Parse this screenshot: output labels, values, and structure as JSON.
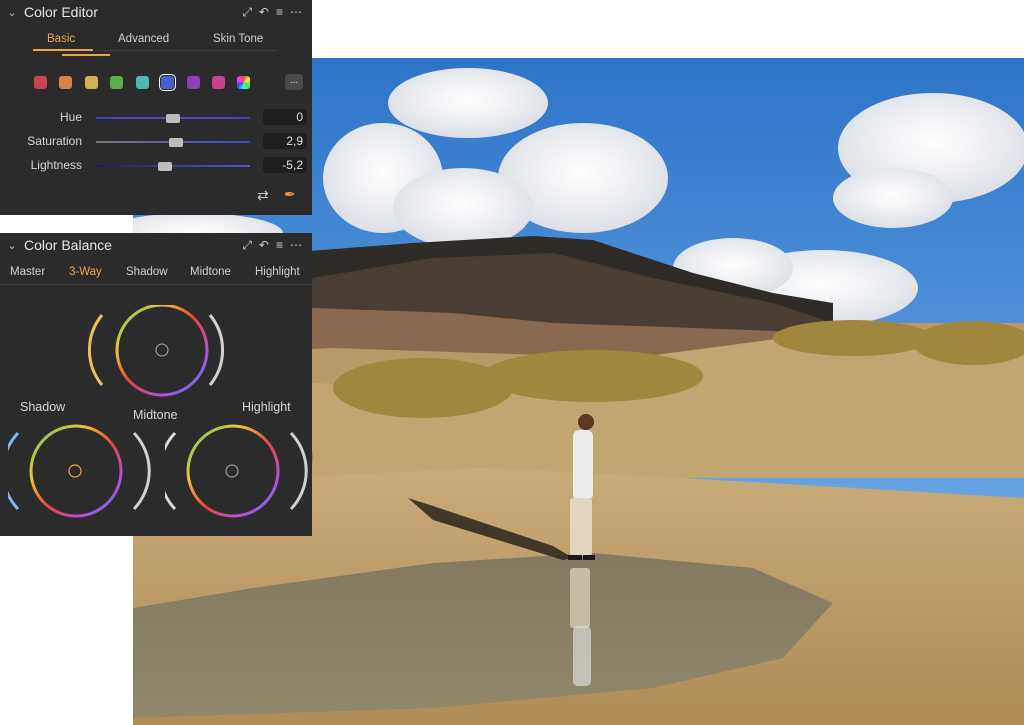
{
  "color_editor": {
    "title": "Color Editor",
    "tabs": [
      {
        "label": "Basic",
        "active": true
      },
      {
        "label": "Advanced",
        "active": false
      },
      {
        "label": "Skin Tone",
        "active": false
      }
    ],
    "swatches": [
      {
        "name": "red",
        "color": "#c8424f"
      },
      {
        "name": "orange",
        "color": "#d6804a"
      },
      {
        "name": "yellow",
        "color": "#cfb14f"
      },
      {
        "name": "green",
        "color": "#5dad4c"
      },
      {
        "name": "cyan",
        "color": "#4fb7b1"
      },
      {
        "name": "blue",
        "color": "#4a5fcf",
        "selected": true
      },
      {
        "name": "purple",
        "color": "#8b3fb8"
      },
      {
        "name": "magenta",
        "color": "#c9428f"
      },
      {
        "name": "all-colors",
        "color": "conic"
      }
    ],
    "more_label": "...",
    "sliders": [
      {
        "label": "Hue",
        "value": "0",
        "level": 0.5
      },
      {
        "label": "Saturation",
        "value": "2,9",
        "level": 0.52
      },
      {
        "label": "Lightness",
        "value": "-5,2",
        "level": 0.45
      }
    ]
  },
  "color_balance": {
    "title": "Color Balance",
    "tabs": [
      {
        "label": "Master",
        "active": false
      },
      {
        "label": "3-Way",
        "active": true
      },
      {
        "label": "Shadow",
        "active": false
      },
      {
        "label": "Midtone",
        "active": false
      },
      {
        "label": "Highlight",
        "active": false
      }
    ],
    "wheels": {
      "shadow_label": "Shadow",
      "midtone_label": "Midtone",
      "highlight_label": "Highlight"
    }
  },
  "colors": {
    "panel_bg": "#2b2b2b",
    "accent": "#f0a24a",
    "text": "#d6d6d6"
  }
}
